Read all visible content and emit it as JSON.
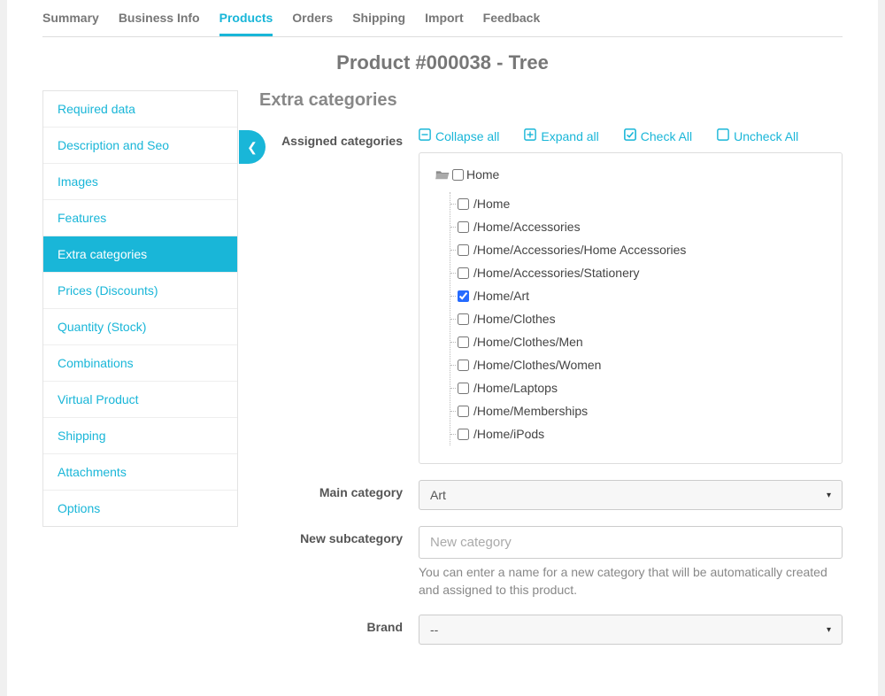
{
  "top_tabs": {
    "items": [
      "Summary",
      "Business Info",
      "Products",
      "Orders",
      "Shipping",
      "Import",
      "Feedback"
    ],
    "active_index": 2
  },
  "page_title": "Product #000038 - Tree",
  "sidebar": {
    "items": [
      "Required data",
      "Description and Seo",
      "Images",
      "Features",
      "Extra categories",
      "Prices (Discounts)",
      "Quantity (Stock)",
      "Combinations",
      "Virtual Product",
      "Shipping",
      "Attachments",
      "Options"
    ],
    "active_index": 4
  },
  "section_heading": "Extra categories",
  "labels": {
    "assigned_categories": "Assigned categories",
    "main_category": "Main category",
    "new_subcategory": "New subcategory",
    "brand": "Brand"
  },
  "tree_actions": {
    "collapse_all": "Collapse all",
    "expand_all": "Expand all",
    "check_all": "Check All",
    "uncheck_all": "Uncheck All"
  },
  "category_tree": {
    "root": {
      "label": "Home",
      "checked": false
    },
    "children": [
      {
        "label": "/Home",
        "checked": false
      },
      {
        "label": "/Home/Accessories",
        "checked": false
      },
      {
        "label": "/Home/Accessories/Home Accessories",
        "checked": false
      },
      {
        "label": "/Home/Accessories/Stationery",
        "checked": false
      },
      {
        "label": "/Home/Art",
        "checked": true
      },
      {
        "label": "/Home/Clothes",
        "checked": false
      },
      {
        "label": "/Home/Clothes/Men",
        "checked": false
      },
      {
        "label": "/Home/Clothes/Women",
        "checked": false
      },
      {
        "label": "/Home/Laptops",
        "checked": false
      },
      {
        "label": "/Home/Memberships",
        "checked": false
      },
      {
        "label": "/Home/iPods",
        "checked": false
      }
    ]
  },
  "main_category_select": {
    "value": "Art"
  },
  "new_subcategory": {
    "placeholder": "New category",
    "help": "You can enter a name for a new category that will be automatically created and assigned to this product."
  },
  "brand_select": {
    "value": "--"
  }
}
